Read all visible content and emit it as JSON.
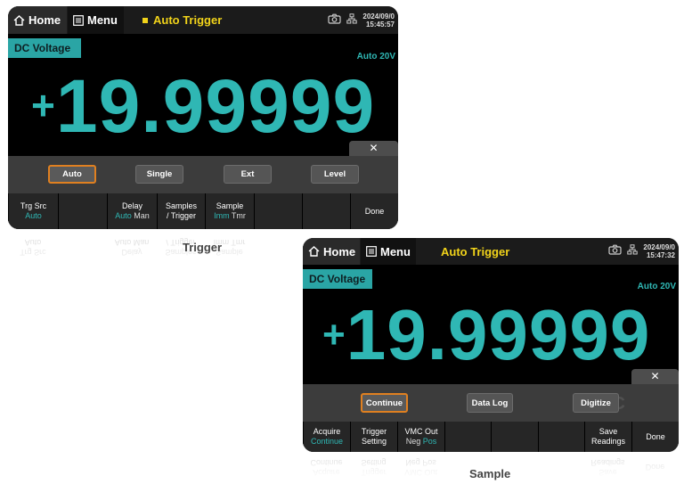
{
  "trigger_screen": {
    "home": "Home",
    "menu": "Menu",
    "mode": "Auto Trigger",
    "clock_date": "2024/09/0",
    "clock_time": "15:45:57",
    "function": "DC Voltage",
    "range": "Auto 20V",
    "sign": "+",
    "reading": "19.99999",
    "close": "✕",
    "options": [
      "Auto",
      "Single",
      "Ext",
      "Level"
    ],
    "selected_option": "Auto",
    "watermark": "DC",
    "softkeys": [
      {
        "line1": "Trg Src",
        "sub": [
          "Auto"
        ],
        "active": 0
      },
      {
        "line1": "",
        "sub": [],
        "active": -1
      },
      {
        "line1": "Delay",
        "sub": [
          "Auto",
          "Man"
        ],
        "active": 0
      },
      {
        "line1": "Samples",
        "line2": "/ Trigger",
        "sub": [],
        "active": -1
      },
      {
        "line1": "Sample",
        "sub": [
          "Imm",
          "Tmr"
        ],
        "active": 0
      },
      {
        "line1": "",
        "sub": [],
        "active": -1
      },
      {
        "line1": "",
        "sub": [],
        "active": -1
      },
      {
        "line1": "Done",
        "sub": [],
        "active": -1
      }
    ],
    "caption": "Trigger"
  },
  "sample_screen": {
    "home": "Home",
    "menu": "Menu",
    "mode": "Auto Trigger",
    "clock_date": "2024/09/0",
    "clock_time": "15:47:32",
    "function": "DC Voltage",
    "range": "Auto 20V",
    "sign": "+",
    "reading": "19.99999",
    "close": "✕",
    "options": [
      "Continue",
      "Data Log",
      "Digitize"
    ],
    "selected_option": "Continue",
    "watermark": "DC",
    "softkeys": [
      {
        "line1": "Acquire",
        "sub": [
          "Continue"
        ],
        "active": 0
      },
      {
        "line1": "Trigger",
        "line2": "Setting",
        "sub": [],
        "active": -1
      },
      {
        "line1": "VMC Out",
        "sub": [
          "Neg",
          "Pos"
        ],
        "active": 1
      },
      {
        "line1": "",
        "sub": [],
        "active": -1
      },
      {
        "line1": "",
        "sub": [],
        "active": -1
      },
      {
        "line1": "",
        "sub": [],
        "active": -1
      },
      {
        "line1": "Save",
        "line2": "Readings",
        "sub": [],
        "active": -1
      },
      {
        "line1": "Done",
        "sub": [],
        "active": -1
      }
    ],
    "caption": "Sample"
  },
  "colors": {
    "accent_teal": "#2fb7b4",
    "mode_yellow": "#f1d31a",
    "selected_border": "#e08020"
  },
  "icons": [
    "home-icon",
    "menu-icon",
    "camera-icon",
    "network-icon",
    "close-icon"
  ]
}
